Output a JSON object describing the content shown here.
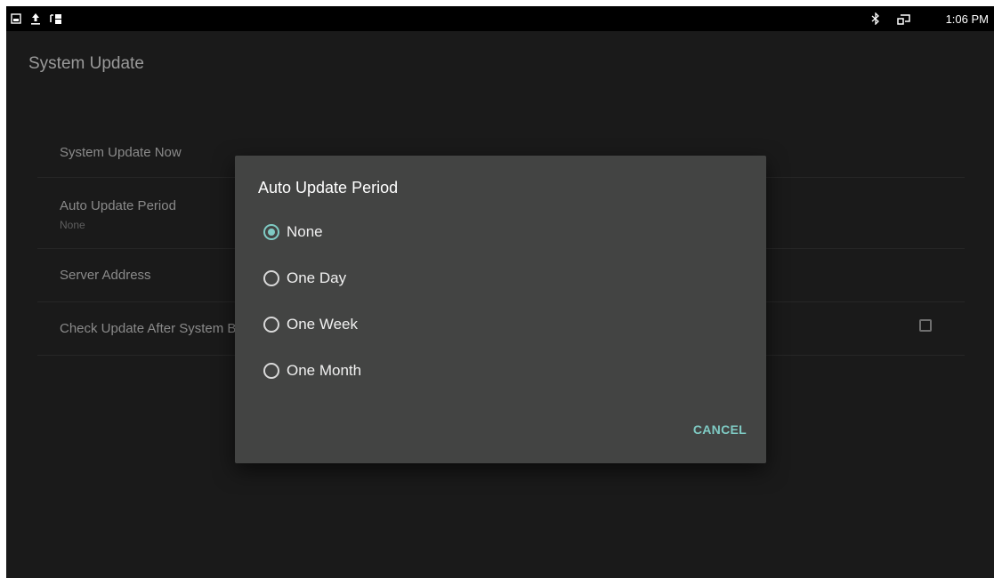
{
  "status_bar": {
    "left_icons": [
      "screenshot-icon",
      "upload-icon",
      "data-transfer-icon"
    ],
    "right_icons": [
      "bluetooth-icon",
      "cast-icon"
    ],
    "time": "1:06 PM"
  },
  "page": {
    "title": "System Update",
    "preferences": [
      {
        "title": "System Update Now",
        "summary": ""
      },
      {
        "title": "Auto Update Period",
        "summary": "None"
      },
      {
        "title": "Server Address",
        "summary": ""
      },
      {
        "title": "Check Update After System Boot",
        "summary": "",
        "checkbox_checked": false
      }
    ]
  },
  "dialog": {
    "title": "Auto Update Period",
    "options": [
      {
        "label": "None",
        "selected": true
      },
      {
        "label": "One Day",
        "selected": false
      },
      {
        "label": "One Week",
        "selected": false
      },
      {
        "label": "One Month",
        "selected": false
      }
    ],
    "cancel_label": "CANCEL"
  },
  "colors": {
    "accent": "#7fcbc4",
    "background": "#1a1a1a",
    "dialog_background": "#434443"
  }
}
